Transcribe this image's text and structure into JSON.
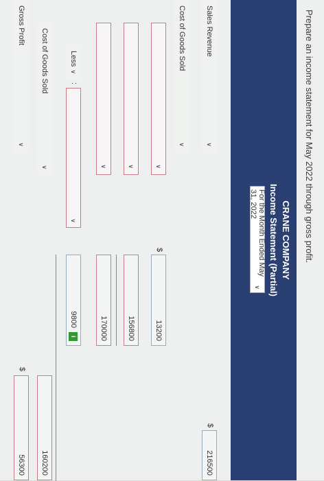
{
  "prompt": "Prepare an income statement for May 2022 through gross profit.",
  "header": {
    "company": "CRANE COMPANY",
    "title": "Income Statement (Partial)",
    "period": "For the Month Ended May 31, 2022"
  },
  "currency_symbol": "$",
  "rows": {
    "sales_revenue": {
      "label": "Sales Revenue",
      "amount": "216500"
    },
    "cost_of_goods_sold": {
      "label": "Cost of Goods Sold"
    },
    "blank_1": {
      "label": "",
      "amount": "13200"
    },
    "blank_2": {
      "label": "",
      "amount": "156800"
    },
    "blank_3": {
      "label": "",
      "amount": "170000"
    },
    "less": {
      "label": "Less",
      "operator": ":",
      "amount": "9800",
      "info": "i"
    },
    "cost_of_goods_sold_2": {
      "label": "Cost of Goods Sold",
      "amount": "160200"
    },
    "gross_profit": {
      "label": "Gross Profit",
      "amount": "56300"
    }
  },
  "colors": {
    "header_bg": "#2a3f72",
    "error_outline": "#c87a86",
    "info_green": "#2e9b2e"
  }
}
